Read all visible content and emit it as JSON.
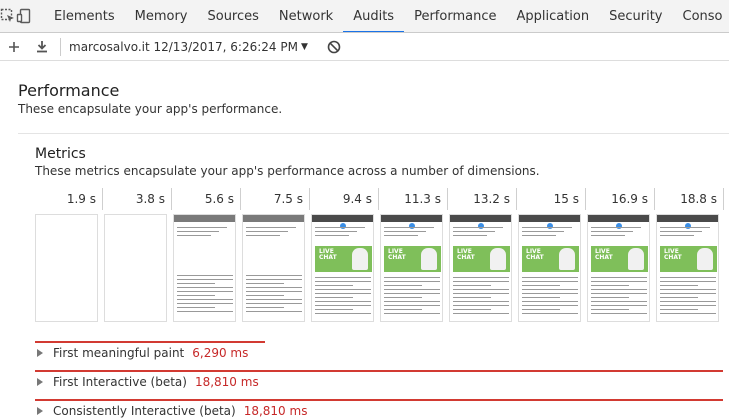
{
  "tabs": [
    {
      "label": "Elements",
      "active": false
    },
    {
      "label": "Memory",
      "active": false
    },
    {
      "label": "Sources",
      "active": false
    },
    {
      "label": "Network",
      "active": false
    },
    {
      "label": "Audits",
      "active": true
    },
    {
      "label": "Performance",
      "active": false
    },
    {
      "label": "Application",
      "active": false
    },
    {
      "label": "Security",
      "active": false
    },
    {
      "label": "Conso",
      "active": false
    }
  ],
  "toolbar": {
    "report_label": "marcosalvo.it 12/13/2017, 6:26:24 PM"
  },
  "section": {
    "title": "Performance",
    "description": "These encapsulate your app's performance."
  },
  "metrics": {
    "title": "Metrics",
    "description": "These metrics encapsulate your app's performance across a number of dimensions.",
    "filmstrip": [
      {
        "time": "1.9 s",
        "content": "blank"
      },
      {
        "time": "3.8 s",
        "content": "blank"
      },
      {
        "time": "5.6 s",
        "content": "text"
      },
      {
        "time": "7.5 s",
        "content": "text"
      },
      {
        "time": "9.4 s",
        "content": "full"
      },
      {
        "time": "11.3 s",
        "content": "full"
      },
      {
        "time": "13.2 s",
        "content": "full"
      },
      {
        "time": "15 s",
        "content": "full"
      },
      {
        "time": "16.9 s",
        "content": "full"
      },
      {
        "time": "18.8 s",
        "content": "full"
      }
    ],
    "hero_text": "LIVE CHAT",
    "rows": [
      {
        "name": "First meaningful paint",
        "value": "6,290 ms",
        "ms": 6290
      },
      {
        "name": "First Interactive (beta)",
        "value": "18,810 ms",
        "ms": 18810
      },
      {
        "name": "Consistently Interactive (beta)",
        "value": "18,810 ms",
        "ms": 18810
      }
    ],
    "scale_max_ms": 18810
  },
  "colors": {
    "accent": "#1a73e8",
    "metric_bar": "#d23a32",
    "metric_value": "#c62828",
    "hero": "#7fbf5a"
  }
}
